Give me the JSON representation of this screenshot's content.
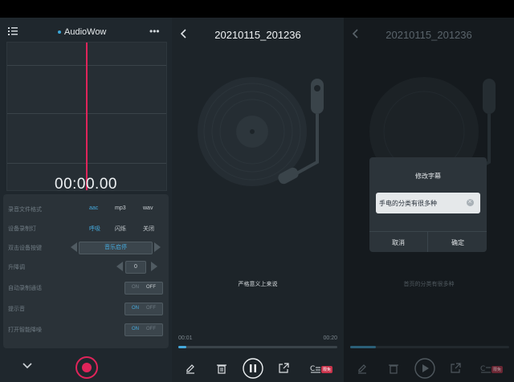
{
  "recorder": {
    "app_name": "AudioWow",
    "timer": "00:00.00",
    "settings": {
      "format_label": "录音文件格式",
      "format_options": [
        "aac",
        "mp3",
        "wav"
      ],
      "format_selected": "aac",
      "light_label": "设备录制灯",
      "light_options": [
        "呼吸",
        "闪烁",
        "关闭"
      ],
      "light_selected": "呼吸",
      "double_click_label": "双击设备按键",
      "double_click_value": "音乐启停",
      "gain_label": "升降调",
      "gain_value": "0",
      "auto_call_label": "自动录制通话",
      "auto_call_on": "ON",
      "auto_call_off": "OFF",
      "auto_call_state": "off",
      "tone_label": "提示音",
      "tone_on": "ON",
      "tone_off": "OFF",
      "tone_state": "on",
      "noise_label": "打开智能降噪",
      "noise_on": "ON",
      "noise_off": "OFF",
      "noise_state": "on"
    }
  },
  "player": {
    "title": "20210115_201236",
    "subtitle_line": "严格意义上来说",
    "time_current": "00:01",
    "time_total": "00:20",
    "progress": 0.05,
    "badge": "限免"
  },
  "edit_view": {
    "title": "20210115_201236",
    "subtitle_line": "首页的分类有很多种",
    "badge": "限免",
    "dialog": {
      "title": "修改字幕",
      "input_value": "手电的分类有很多种",
      "cancel": "取消",
      "confirm": "确定"
    }
  },
  "colors": {
    "accent": "#45a9dc",
    "record": "#e0245a"
  }
}
